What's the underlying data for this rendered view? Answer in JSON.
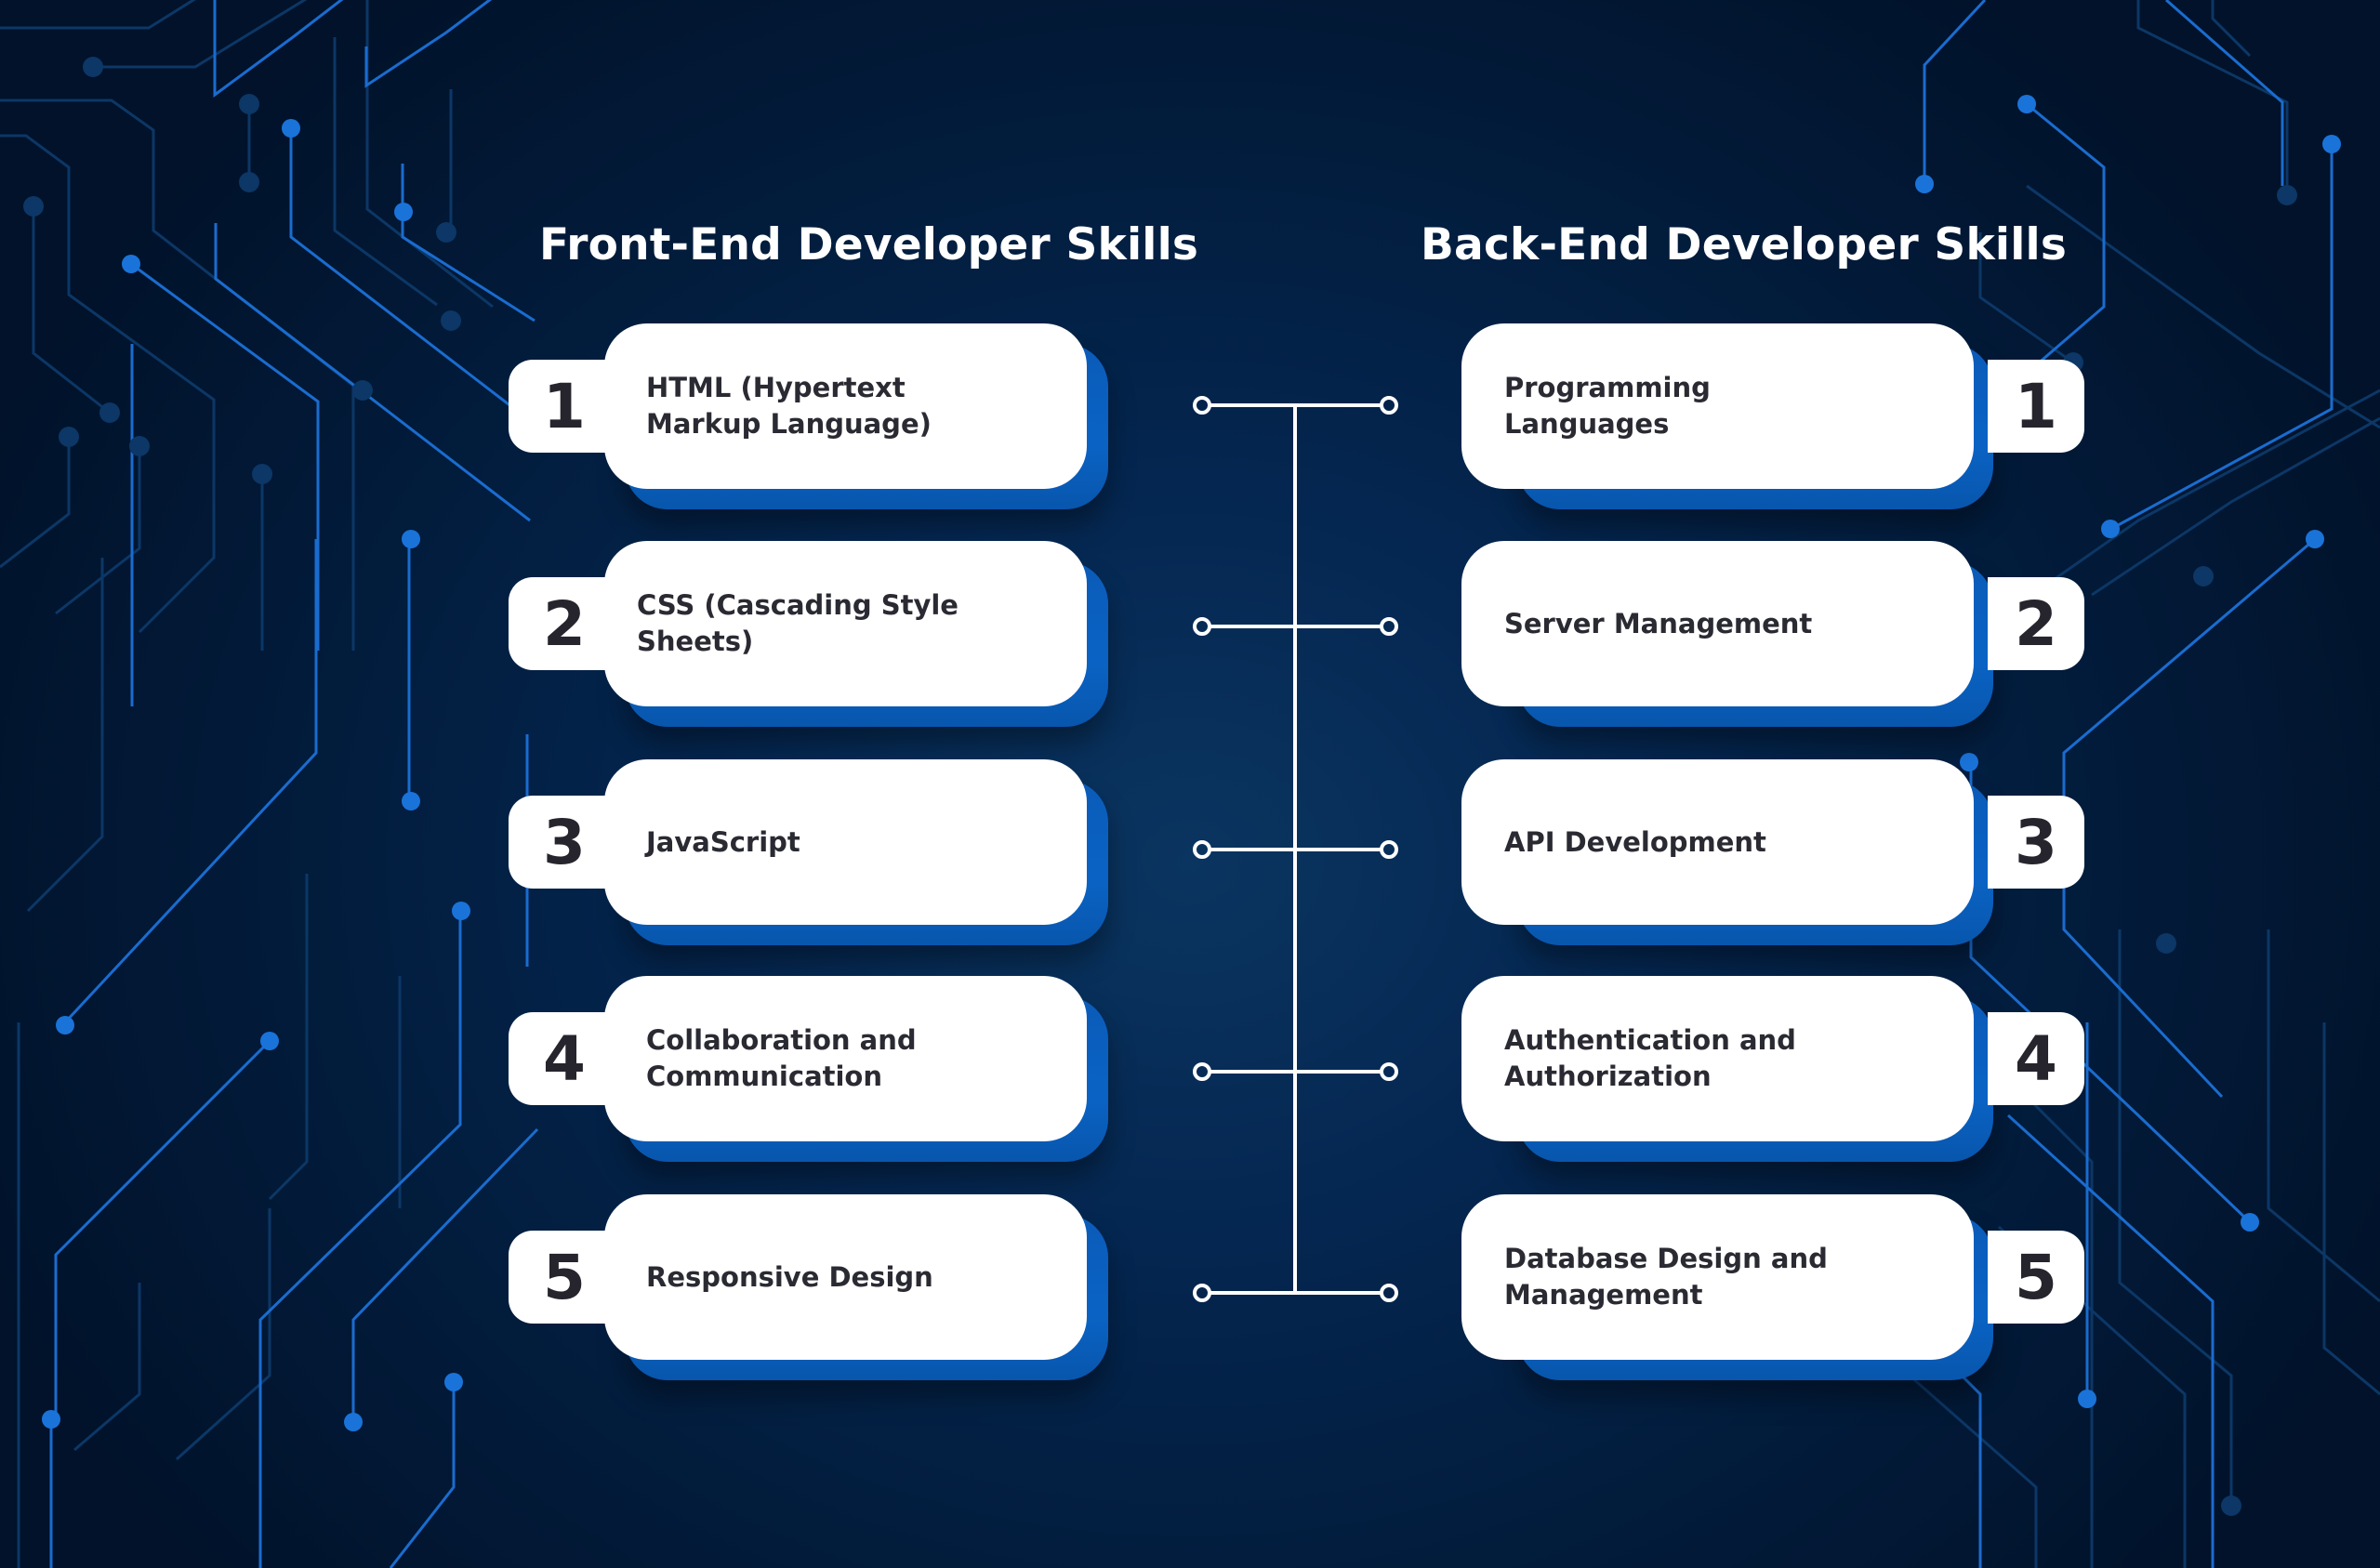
{
  "colors": {
    "background": "#021b3a",
    "card": "#ffffff",
    "card_shadow": "#0a63c4",
    "text_dark": "#2a2a33",
    "title": "#ffffff",
    "connector": "#ffffff",
    "trace_bright": "#1a73d9",
    "trace_dim": "#0c3766"
  },
  "front_end": {
    "title": "Front-End Developer Skills",
    "items": [
      {
        "number": "1",
        "label": "HTML (Hypertext Markup Language)"
      },
      {
        "number": "2",
        "label": "CSS (Cascading Style Sheets)"
      },
      {
        "number": "3",
        "label": "JavaScript"
      },
      {
        "number": "4",
        "label": "Collaboration and Communication"
      },
      {
        "number": "5",
        "label": "Responsive Design"
      }
    ]
  },
  "back_end": {
    "title": "Back-End Developer Skills",
    "items": [
      {
        "number": "1",
        "label": "Programming Languages"
      },
      {
        "number": "2",
        "label": "Server Management"
      },
      {
        "number": "3",
        "label": "API Development"
      },
      {
        "number": "4",
        "label": "Authentication and Authorization"
      },
      {
        "number": "5",
        "label": " Database Design and Management"
      }
    ]
  },
  "icons": {
    "background": "circuit-board-traces",
    "connector": "t-bar-connector-with-ring-terminals"
  }
}
